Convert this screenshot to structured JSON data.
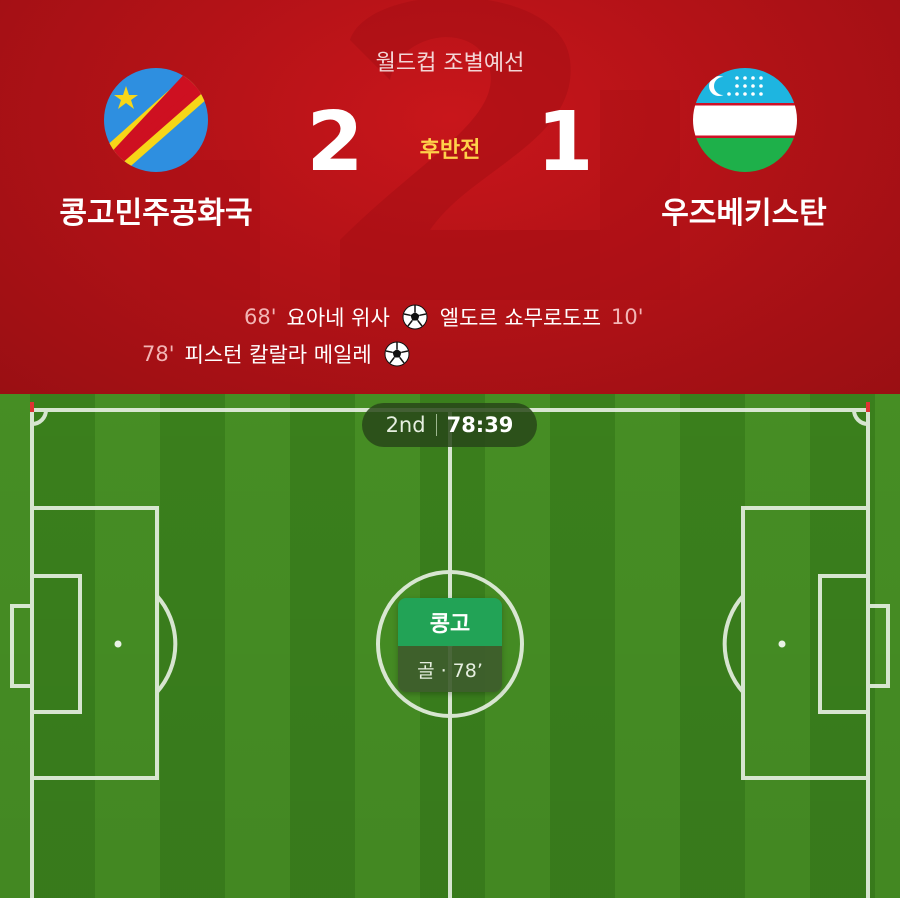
{
  "match": {
    "competition": "월드컵 조별예선",
    "period": "후반전",
    "home": {
      "name": "콩고민주공화국",
      "score": "2",
      "flag_icon": "drc-flag-icon"
    },
    "away": {
      "name": "우즈베키스탄",
      "score": "1",
      "flag_icon": "uzbekistan-flag-icon"
    }
  },
  "events": {
    "home": [
      {
        "minute": "68'",
        "player": "요아네 위사"
      },
      {
        "minute": "78'",
        "player": "피스턴 칼랄라 메일레"
      }
    ],
    "away": [
      {
        "minute": "10'",
        "player": "엘도르 쇼무로도프"
      }
    ]
  },
  "clock": {
    "half": "2nd",
    "time": "78:39"
  },
  "event_card": {
    "team": "콩고",
    "detail": "골 · 78’"
  },
  "colors": {
    "header_red": "#b31217",
    "period_yellow": "#ffd24a",
    "pitch_light": "#4c9a27",
    "pitch_dark": "#3f8a1f",
    "card_green": "#22a356"
  }
}
